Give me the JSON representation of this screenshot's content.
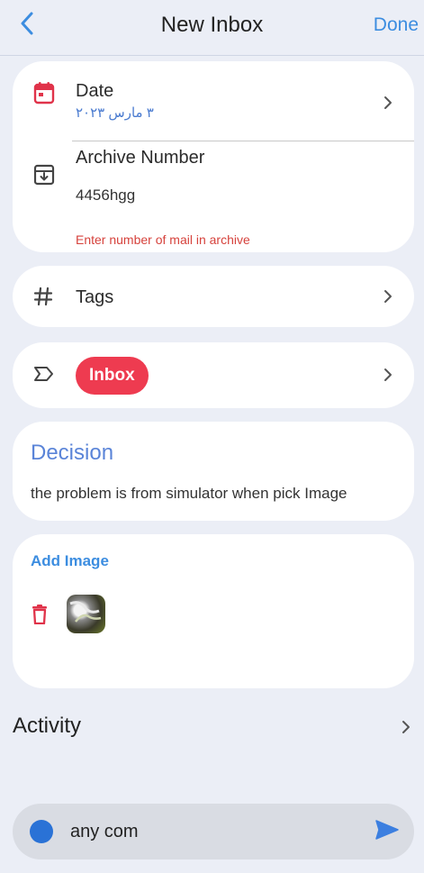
{
  "header": {
    "title": "New Inbox",
    "done_label": "Done",
    "back_icon": "chevron-left-icon"
  },
  "details": {
    "date_label": "Date",
    "date_value": "٣ مارس ٢٠٢٣",
    "archive_label": "Archive Number",
    "archive_value": "4456hgg",
    "archive_error": "Enter number of mail in archive"
  },
  "tags": {
    "label": "Tags"
  },
  "category": {
    "chip_label": "Inbox",
    "chip_color": "#ee3b50"
  },
  "decision": {
    "title": "Decision",
    "text": "the problem is from simulator when pick Image"
  },
  "images": {
    "add_label": "Add Image"
  },
  "activity": {
    "label": "Activity"
  },
  "compose": {
    "value": "any com",
    "accent": "#2a72d6"
  },
  "colors": {
    "accent": "#3c8de0",
    "icon_red": "#e0334a",
    "error": "#d6423c",
    "background": "#ebeef6"
  }
}
